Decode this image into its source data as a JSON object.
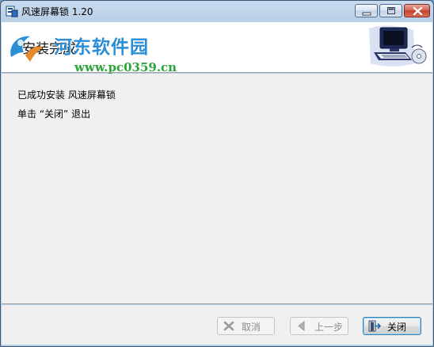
{
  "window": {
    "title": "风速屏幕锁 1.20"
  },
  "watermark": {
    "site_name": "河东软件园",
    "url": "www.pc0359.cn"
  },
  "header": {
    "title": "安装完成"
  },
  "body": {
    "line1": "已成功安装 风速屏幕锁",
    "line2": "单击 “关闭” 退出"
  },
  "buttons": {
    "cancel": "取消",
    "back": "上一步",
    "close": "关闭"
  },
  "icons": {
    "app": "installer-icon",
    "header_graphic": "computer-cd-icon",
    "cancel": "x-icon",
    "back": "back-arrow-icon",
    "close": "exit-door-icon"
  },
  "colors": {
    "titlebar": "#b9cfe6",
    "watermark_blue": "#2c8ed6",
    "watermark_green": "#2aa53a",
    "close_button": "#c2402a"
  }
}
